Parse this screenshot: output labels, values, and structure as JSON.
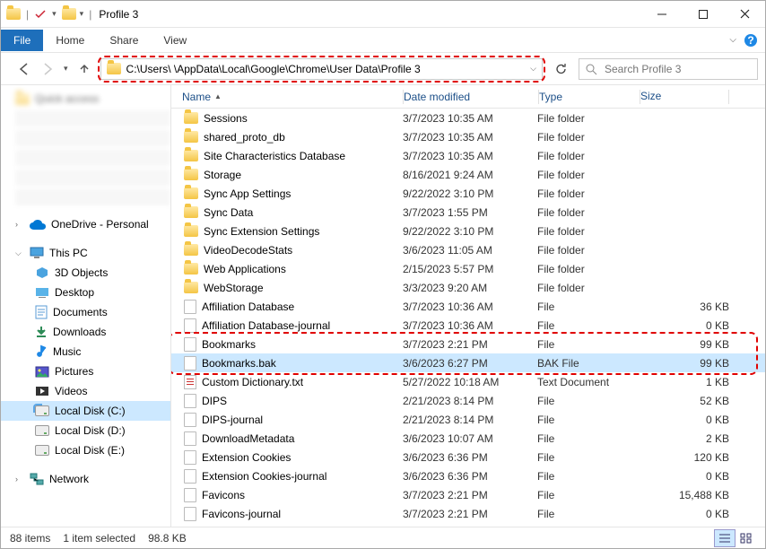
{
  "title": "Profile 3",
  "menu": {
    "file": "File",
    "home": "Home",
    "share": "Share",
    "view": "View"
  },
  "address_path": "C:\\Users\\        \\AppData\\Local\\Google\\Chrome\\User Data\\Profile 3",
  "search": {
    "placeholder": "Search Profile 3"
  },
  "columns": {
    "name": "Name",
    "date": "Date modified",
    "type": "Type",
    "size": "Size"
  },
  "nav": {
    "onedrive": "OneDrive - Personal",
    "thispc": "This PC",
    "items": [
      {
        "label": "3D Objects"
      },
      {
        "label": "Desktop"
      },
      {
        "label": "Documents"
      },
      {
        "label": "Downloads"
      },
      {
        "label": "Music"
      },
      {
        "label": "Pictures"
      },
      {
        "label": "Videos"
      },
      {
        "label": "Local Disk (C:)"
      },
      {
        "label": "Local Disk (D:)"
      },
      {
        "label": "Local Disk (E:)"
      }
    ],
    "network": "Network"
  },
  "files": [
    {
      "name": "Sessions",
      "date": "3/7/2023 10:35 AM",
      "type": "File folder",
      "size": "",
      "kind": "folder"
    },
    {
      "name": "shared_proto_db",
      "date": "3/7/2023 10:35 AM",
      "type": "File folder",
      "size": "",
      "kind": "folder"
    },
    {
      "name": "Site Characteristics Database",
      "date": "3/7/2023 10:35 AM",
      "type": "File folder",
      "size": "",
      "kind": "folder"
    },
    {
      "name": "Storage",
      "date": "8/16/2021 9:24 AM",
      "type": "File folder",
      "size": "",
      "kind": "folder"
    },
    {
      "name": "Sync App Settings",
      "date": "9/22/2022 3:10 PM",
      "type": "File folder",
      "size": "",
      "kind": "folder"
    },
    {
      "name": "Sync Data",
      "date": "3/7/2023 1:55 PM",
      "type": "File folder",
      "size": "",
      "kind": "folder"
    },
    {
      "name": "Sync Extension Settings",
      "date": "9/22/2022 3:10 PM",
      "type": "File folder",
      "size": "",
      "kind": "folder"
    },
    {
      "name": "VideoDecodeStats",
      "date": "3/6/2023 11:05 AM",
      "type": "File folder",
      "size": "",
      "kind": "folder"
    },
    {
      "name": "Web Applications",
      "date": "2/15/2023 5:57 PM",
      "type": "File folder",
      "size": "",
      "kind": "folder"
    },
    {
      "name": "WebStorage",
      "date": "3/3/2023 9:20 AM",
      "type": "File folder",
      "size": "",
      "kind": "folder"
    },
    {
      "name": "Affiliation Database",
      "date": "3/7/2023 10:36 AM",
      "type": "File",
      "size": "36 KB",
      "kind": "file"
    },
    {
      "name": "Affiliation Database-journal",
      "date": "3/7/2023 10:36 AM",
      "type": "File",
      "size": "0 KB",
      "kind": "file"
    },
    {
      "name": "Bookmarks",
      "date": "3/7/2023 2:21 PM",
      "type": "File",
      "size": "99 KB",
      "kind": "file"
    },
    {
      "name": "Bookmarks.bak",
      "date": "3/6/2023 6:27 PM",
      "type": "BAK File",
      "size": "99 KB",
      "kind": "file",
      "selected": true
    },
    {
      "name": "Custom Dictionary.txt",
      "date": "5/27/2022 10:18 AM",
      "type": "Text Document",
      "size": "1 KB",
      "kind": "txt"
    },
    {
      "name": "DIPS",
      "date": "2/21/2023 8:14 PM",
      "type": "File",
      "size": "52 KB",
      "kind": "file"
    },
    {
      "name": "DIPS-journal",
      "date": "2/21/2023 8:14 PM",
      "type": "File",
      "size": "0 KB",
      "kind": "file"
    },
    {
      "name": "DownloadMetadata",
      "date": "3/6/2023 10:07 AM",
      "type": "File",
      "size": "2 KB",
      "kind": "file"
    },
    {
      "name": "Extension Cookies",
      "date": "3/6/2023 6:36 PM",
      "type": "File",
      "size": "120 KB",
      "kind": "file"
    },
    {
      "name": "Extension Cookies-journal",
      "date": "3/6/2023 6:36 PM",
      "type": "File",
      "size": "0 KB",
      "kind": "file"
    },
    {
      "name": "Favicons",
      "date": "3/7/2023 2:21 PM",
      "type": "File",
      "size": "15,488 KB",
      "kind": "file"
    },
    {
      "name": "Favicons-journal",
      "date": "3/7/2023 2:21 PM",
      "type": "File",
      "size": "0 KB",
      "kind": "file"
    }
  ],
  "status": {
    "items": "88 items",
    "selected": "1 item selected",
    "size": "98.8 KB"
  }
}
